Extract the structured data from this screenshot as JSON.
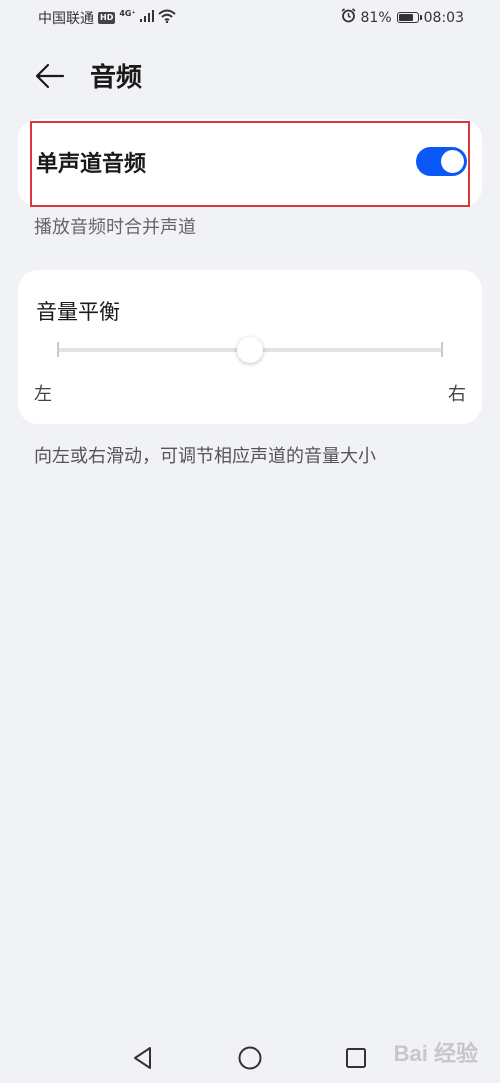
{
  "status_bar": {
    "carrier": "中国联通",
    "hd": "HD",
    "network": "4G⁺",
    "battery_percent": "81%",
    "battery_level": 0.81,
    "time": "08:03",
    "icons": [
      "signal-icon",
      "wifi-icon",
      "alarm-icon",
      "battery-icon"
    ]
  },
  "header": {
    "title": "音频",
    "back_icon": "arrow-left-icon"
  },
  "mono_audio": {
    "label": "单声道音频",
    "enabled": true,
    "description": "播放音频时合并声道"
  },
  "balance": {
    "label": "音量平衡",
    "value": 0.5,
    "left_label": "左",
    "right_label": "右",
    "description": "向左或右滑动，可调节相应声道的音量大小"
  },
  "nav_bar": {
    "buttons": [
      "back-triangle-icon",
      "home-circle-icon",
      "recent-square-icon"
    ]
  },
  "watermark": "Bai 经验",
  "colors": {
    "accent": "#0a59f7",
    "highlight": "#d9363e",
    "background": "#f1f2f5",
    "card": "#ffffff"
  }
}
